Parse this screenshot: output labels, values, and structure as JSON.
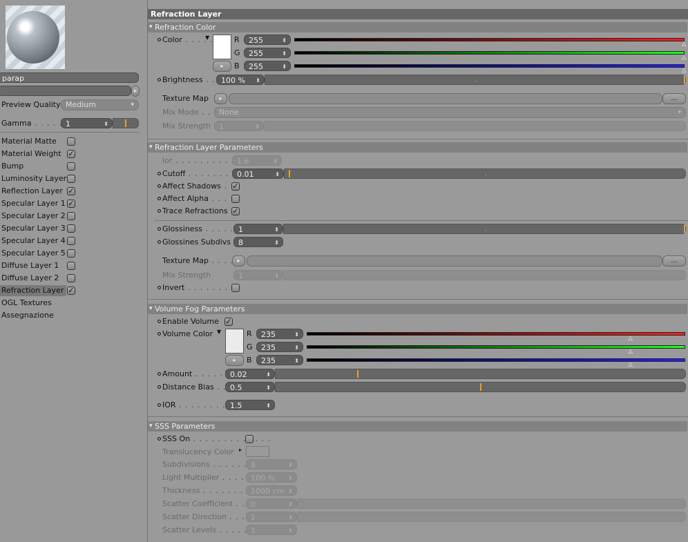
{
  "left": {
    "material_name": "parap",
    "preview_quality_label": "Preview Quality",
    "preview_quality_value": "Medium",
    "gamma_label": "Gamma",
    "gamma_value": "1",
    "gamma_level": 0.5,
    "channels": [
      {
        "label": "Material Matte",
        "checked": false
      },
      {
        "label": "Material Weight",
        "checked": true
      },
      {
        "label": "Bump",
        "checked": false
      },
      {
        "label": "Luminosity Layer",
        "checked": false
      },
      {
        "label": "Reflection Layer",
        "checked": true
      },
      {
        "label": "Specular Layer 1",
        "checked": true
      },
      {
        "label": "Specular Layer 2",
        "checked": false
      },
      {
        "label": "Specular Layer 3",
        "checked": false
      },
      {
        "label": "Specular Layer 4",
        "checked": false
      },
      {
        "label": "Specular Layer 5",
        "checked": false
      },
      {
        "label": "Diffuse Layer 1",
        "checked": false
      },
      {
        "label": "Diffuse Layer 2",
        "checked": false
      },
      {
        "label": "Refraction Layer",
        "checked": true,
        "selected": true
      },
      {
        "label": "OGL Textures"
      },
      {
        "label": "Assegnazione"
      }
    ]
  },
  "right": {
    "title": "Refraction Layer",
    "refraction_color": {
      "header": "Refraction Color",
      "color_label": "Color",
      "r": "255",
      "g": "255",
      "b": "255",
      "color_hex": "#ffffff",
      "brightness_label": "Brightness",
      "brightness": "100 %",
      "brightness_level": 1.0,
      "texture_label": "Texture Map",
      "more": "...",
      "mix_mode_label": "Mix Mode",
      "mix_mode": "None",
      "mix_strength_label": "Mix Strength",
      "mix_strength": "1"
    },
    "params": {
      "header": "Refraction Layer Parameters",
      "ior_label": "Ior",
      "ior": "1.6",
      "cutoff_label": "Cutoff",
      "cutoff": "0.01",
      "cutoff_level": 0.01,
      "affect_shadows_label": "Affect Shadows",
      "affect_shadows": true,
      "affect_alpha_label": "Affect Alpha",
      "affect_alpha": false,
      "trace_label": "Trace Refractions",
      "trace": true,
      "gloss_label": "Glossiness",
      "gloss": "1",
      "gloss_level": 1.0,
      "gloss_subdivs_label": "Glossines Subdivs",
      "gloss_subdivs": "8",
      "texture_label": "Texture Map",
      "more": "...",
      "mix_strength_label": "Mix Strength",
      "mix_strength": "1",
      "invert_label": "Invert",
      "invert": false
    },
    "fog": {
      "header": "Volume Fog Parameters",
      "enable_label": "Enable Volume",
      "enable": true,
      "color_label": "Volume Color",
      "r": "235",
      "g": "235",
      "b": "235",
      "color_hex": "#ebebeb",
      "amount_label": "Amount",
      "amount": "0.02",
      "amount_level": 0.02,
      "bias_label": "Distance Bias",
      "bias": "0.5",
      "bias_level": 0.5,
      "ior_label": "IOR",
      "ior": "1.5"
    },
    "sss": {
      "header": "SSS Parameters",
      "on_label": "SSS On",
      "on": false,
      "transl_label": "Translucency Color",
      "subdiv_label": "Subdivisions",
      "subdiv": "8",
      "light_label": "Light Multiplier",
      "light": "100 %",
      "thick_label": "Thickness",
      "thick": "1000 cm",
      "coef_label": "Scatter Coefficient",
      "coef": "0",
      "dir_label": "Scatter Direction",
      "dir": "1",
      "levels_label": "Scatter Levels",
      "levels": "1"
    }
  }
}
